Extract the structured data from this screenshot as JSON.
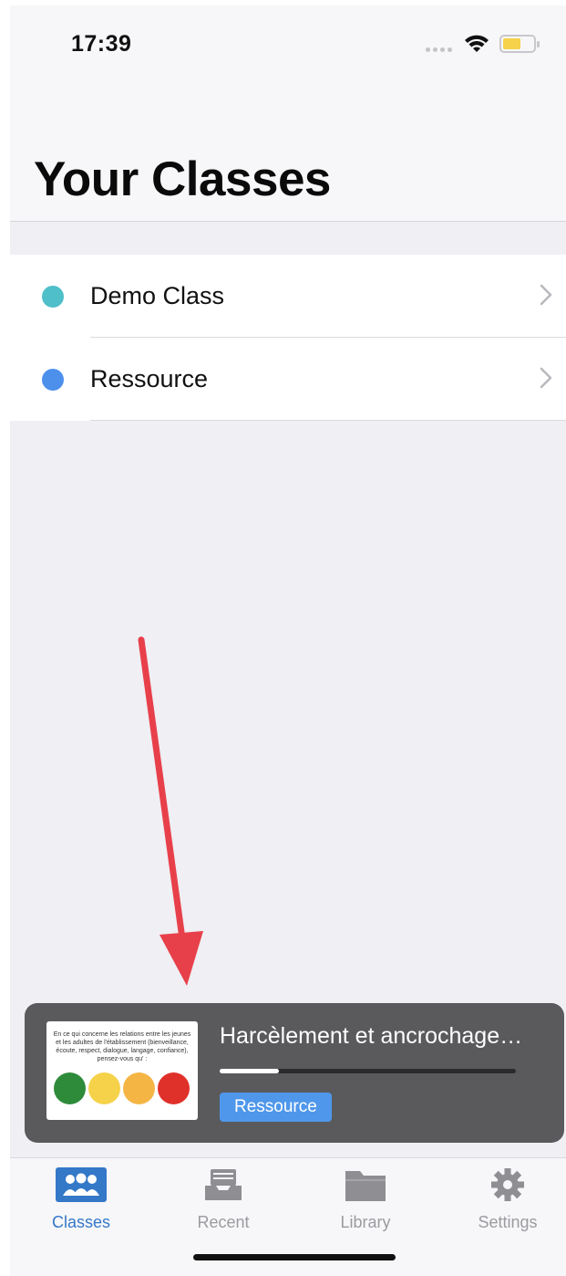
{
  "status_bar": {
    "time": "17:39"
  },
  "page": {
    "title": "Your Classes"
  },
  "classes": [
    {
      "name": "Demo Class",
      "color": "#4fbfca"
    },
    {
      "name": "Ressource",
      "color": "#4d90ec"
    }
  ],
  "player": {
    "title": "Harcèlement et ancrochage…",
    "class_badge": "Ressource",
    "progress": 0.2,
    "thumbnail": {
      "question": "En ce qui concerne les relations entre les jeunes et les adultes de l'établissement (bienveillance, écoute, respect, dialogue, langage, confiance), pensez-vous qu' :",
      "circle_colors": [
        "#2e8b3a",
        "#f5d24a",
        "#f5b545",
        "#e0302a"
      ]
    }
  },
  "annotation": {
    "arrow_color": "#e8404a"
  },
  "tabs": [
    {
      "label": "Classes",
      "icon": "classes-icon",
      "active": true
    },
    {
      "label": "Recent",
      "icon": "recent-tray-icon",
      "active": false
    },
    {
      "label": "Library",
      "icon": "folder-icon",
      "active": false
    },
    {
      "label": "Settings",
      "icon": "gear-icon",
      "active": false
    }
  ]
}
